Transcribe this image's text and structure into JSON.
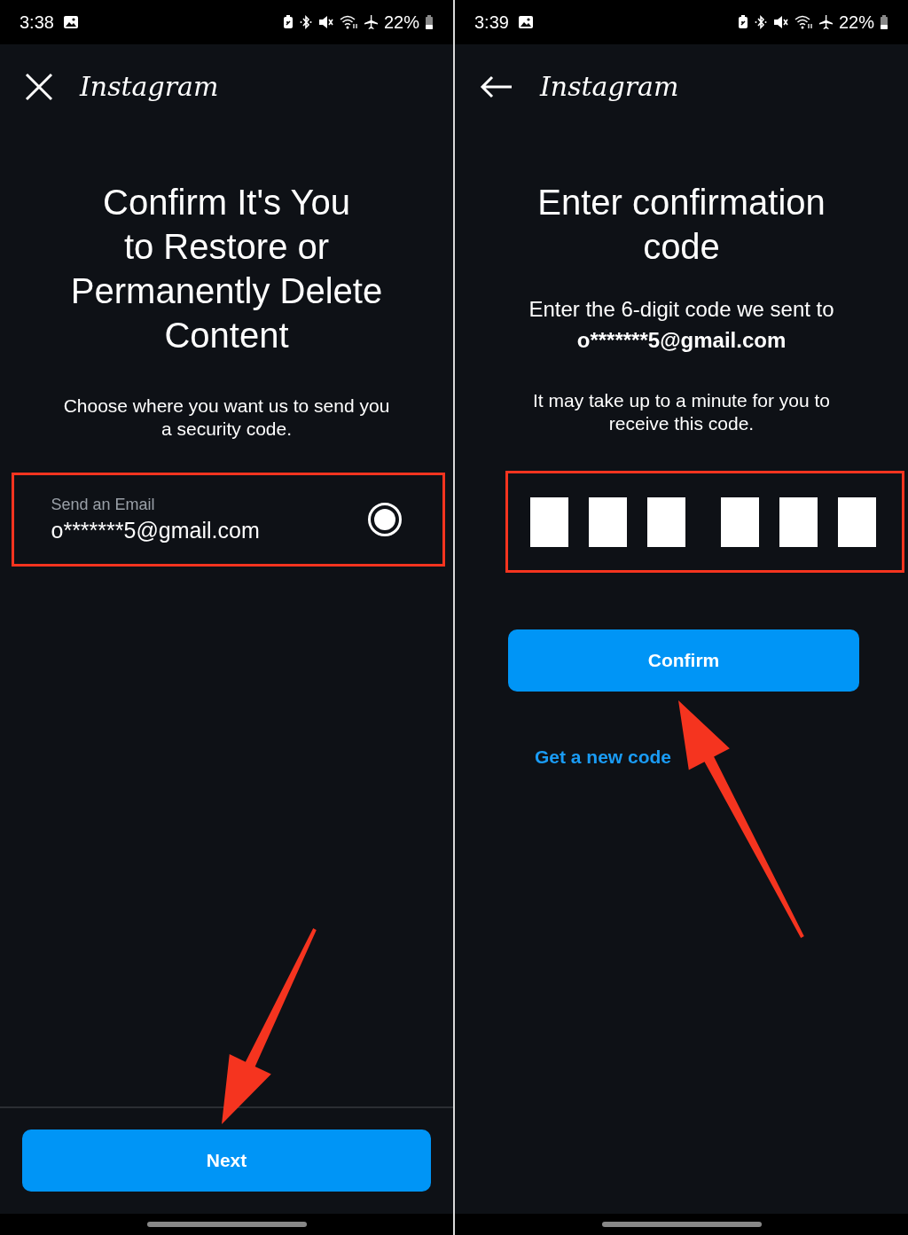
{
  "screens": [
    {
      "status_bar": {
        "time": "3:38",
        "battery": "22%"
      },
      "nav_button": {
        "kind": "close"
      },
      "logo": "Instagram",
      "blocks": [
        {
          "kind": "title",
          "text": "Confirm It's You\nto Restore or\nPermanently Delete\nContent"
        },
        {
          "kind": "note",
          "text": "Choose where you want us to send you\na security code."
        },
        {
          "kind": "option",
          "label": "Send an Email",
          "value": "o*******5@gmail.com",
          "selected": true
        }
      ],
      "footer_button": "Next"
    },
    {
      "status_bar": {
        "time": "3:39",
        "battery": "22%"
      },
      "nav_button": {
        "kind": "back"
      },
      "logo": "Instagram",
      "blocks": [
        {
          "kind": "title",
          "text": "Enter confirmation\ncode"
        },
        {
          "kind": "prompt",
          "text": "Enter the 6-digit code we sent to"
        },
        {
          "kind": "email",
          "text": "o*******5@gmail.com"
        },
        {
          "kind": "note",
          "text": "It may take up to a minute for you to\nreceive this code."
        },
        {
          "kind": "code",
          "groups": [
            [
              {
                "kind": "digit"
              },
              {
                "kind": "digit"
              },
              {
                "kind": "digit"
              }
            ],
            [
              {
                "kind": "digit"
              },
              {
                "kind": "digit"
              },
              {
                "kind": "digit"
              }
            ]
          ]
        },
        {
          "kind": "button",
          "text": "Confirm"
        },
        {
          "kind": "link",
          "text": "Get a new code"
        }
      ]
    }
  ]
}
